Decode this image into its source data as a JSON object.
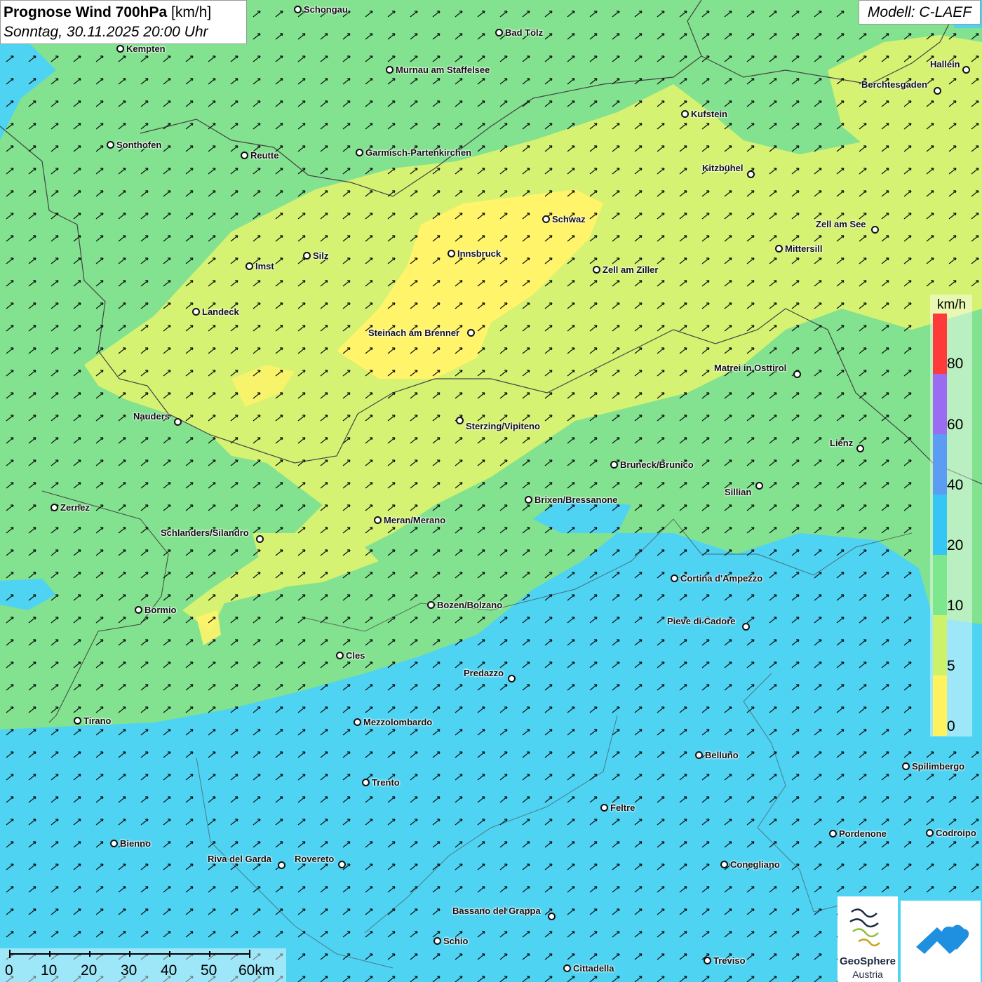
{
  "header": {
    "title_bold": "Prognose Wind 700hPa",
    "title_unit": "[km/h]",
    "datetime": "Sonntag, 30.11.2025 20:00 Uhr",
    "model": "Modell: C-LAEF"
  },
  "legend": {
    "unit": "km/h",
    "ticks": [
      "80",
      "60",
      "40",
      "20",
      "10",
      "5",
      "0"
    ],
    "colors": [
      "#ff3a3a",
      "#9b6bf2",
      "#5c9cf2",
      "#35c6f4",
      "#7de78d",
      "#cdf26a",
      "#fff25c"
    ]
  },
  "scale_bar": {
    "labels": [
      "0",
      "10",
      "20",
      "30",
      "40",
      "50",
      "60km"
    ]
  },
  "cities": [
    {
      "name": "Schongau"
    },
    {
      "name": "Bad Tölz"
    },
    {
      "name": "Kempten"
    },
    {
      "name": "Murnau am Staffelsee"
    },
    {
      "name": "Hallein"
    },
    {
      "name": "Berchtesgaden"
    },
    {
      "name": "Kufstein"
    },
    {
      "name": "Sonthofen"
    },
    {
      "name": "Reutte"
    },
    {
      "name": "Garmisch-Partenkirchen"
    },
    {
      "name": "Kitzbühel"
    },
    {
      "name": "Schwaz"
    },
    {
      "name": "Zell am See"
    },
    {
      "name": "Innsbruck"
    },
    {
      "name": "Mittersill"
    },
    {
      "name": "Imst"
    },
    {
      "name": "Silz"
    },
    {
      "name": "Zell am Ziller"
    },
    {
      "name": "Landeck"
    },
    {
      "name": "Steinach am Brenner"
    },
    {
      "name": "Matrei in Osttirol"
    },
    {
      "name": "Nauders"
    },
    {
      "name": "Sterzing/Vipiteno"
    },
    {
      "name": "Lienz"
    },
    {
      "name": "Bruneck/Brunico"
    },
    {
      "name": "Sillian"
    },
    {
      "name": "Brixen/Bressanone"
    },
    {
      "name": "Zernez"
    },
    {
      "name": "Meran/Merano"
    },
    {
      "name": "Schlanders/Silandro"
    },
    {
      "name": "Cortina d'Ampezzo"
    },
    {
      "name": "Bozen/Bolzano"
    },
    {
      "name": "Bormio"
    },
    {
      "name": "Pieve di Cadore"
    },
    {
      "name": "Cles"
    },
    {
      "name": "Predazzo"
    },
    {
      "name": "Tirano"
    },
    {
      "name": "Mezzolombardo"
    },
    {
      "name": "Belluno"
    },
    {
      "name": "Spilimbergo"
    },
    {
      "name": "Trento"
    },
    {
      "name": "Feltre"
    },
    {
      "name": "Pordenone"
    },
    {
      "name": "Codroipo"
    },
    {
      "name": "Bienno"
    },
    {
      "name": "Riva del Garda"
    },
    {
      "name": "Rovereto"
    },
    {
      "name": "Conegliano"
    },
    {
      "name": "Bassano del Grappa"
    },
    {
      "name": "Schio"
    },
    {
      "name": "Treviso"
    },
    {
      "name": "Cittadella"
    }
  ],
  "logos": {
    "geosphere_line1": "GeoSphere",
    "geosphere_line2": "Austria"
  },
  "colors": {
    "yellow": "#fff46a",
    "yellow_green": "#d5f273",
    "green": "#82e28f",
    "cyan": "#4fd3f3",
    "border": "#444444"
  }
}
